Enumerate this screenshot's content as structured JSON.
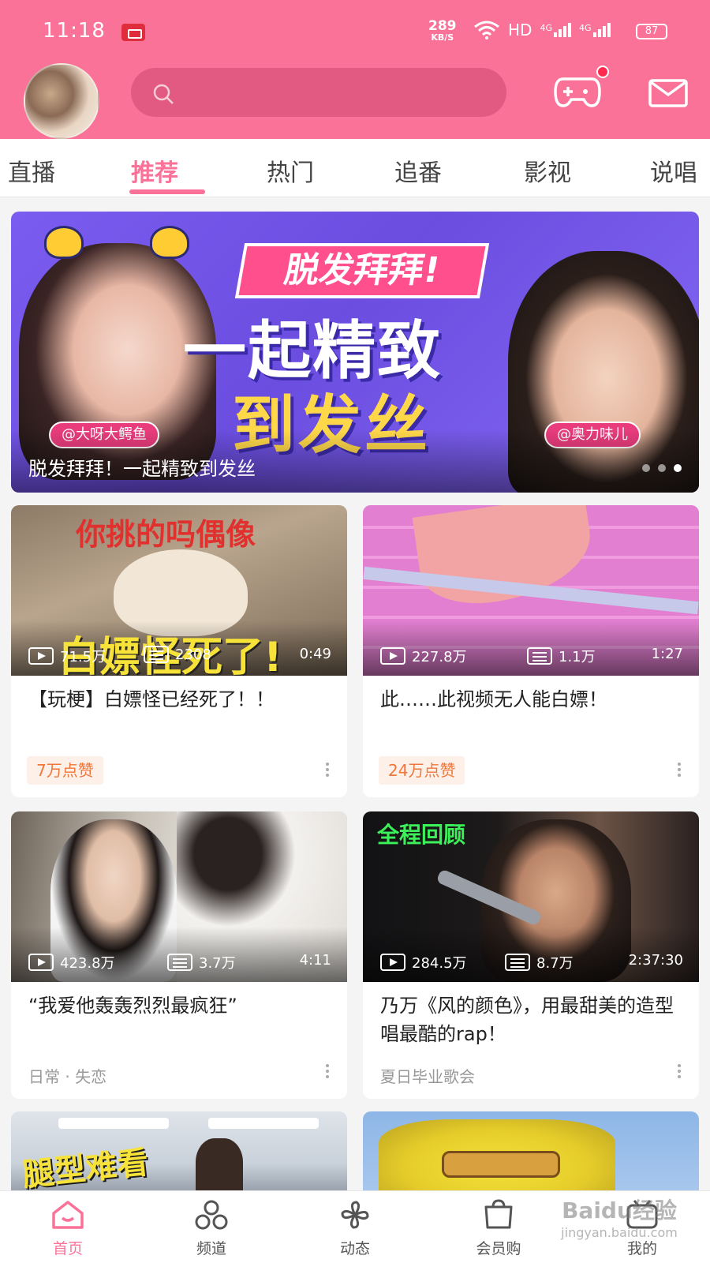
{
  "status_bar": {
    "time": "11:18",
    "net_speed_value": "289",
    "net_speed_unit": "KB/S",
    "hd": "HD",
    "signal1": "4G",
    "signal2": "4G",
    "battery": "87"
  },
  "header": {
    "accent_color": "#fb7299",
    "search_placeholder": ""
  },
  "tabs": [
    {
      "label": "直播"
    },
    {
      "label": "推荐",
      "active": true
    },
    {
      "label": "热门"
    },
    {
      "label": "追番"
    },
    {
      "label": "影视"
    },
    {
      "label": "说唱"
    }
  ],
  "banner": {
    "sign_text": "脱发拜拜!",
    "headline_1": "一起精致",
    "headline_2": "到发丝",
    "tag_left": "@大呀大鳄鱼",
    "tag_right": "@奥力味儿",
    "caption": "脱发拜拜！一起精致到发丝",
    "dots": 3,
    "active_dot": 2
  },
  "cards": [
    {
      "overlay_top": "你挑的吗偶像",
      "overlay_bottom": "白嫖怪死了!",
      "plays": "71.5万",
      "danmaku": "2308",
      "duration": "0:49",
      "title": "【玩梗】白嫖怪已经死了！！",
      "badge": "7万点赞"
    },
    {
      "plays": "227.8万",
      "danmaku": "1.1万",
      "duration": "1:27",
      "title": "此……此视频无人能白嫖！",
      "badge": "24万点赞"
    },
    {
      "plays": "423.8万",
      "danmaku": "3.7万",
      "duration": "4:11",
      "title": "“我爱他轰轰烈烈最疯狂”",
      "subline": "日常 · 失恋"
    },
    {
      "overlay_top": "全程回顾",
      "plays": "284.5万",
      "danmaku": "8.7万",
      "duration": "2:37:30",
      "title": "乃万《风的颜色》，用最甜美的造型唱最酷的rap！",
      "subline": "夏日毕业歌会"
    },
    {
      "overlay_top": "腿型难看"
    },
    {}
  ],
  "bottom_nav": [
    {
      "label": "首页",
      "icon": "home-icon",
      "active": true
    },
    {
      "label": "频道",
      "icon": "channel-icon"
    },
    {
      "label": "动态",
      "icon": "dynamic-icon"
    },
    {
      "label": "会员购",
      "icon": "shop-icon"
    },
    {
      "label": "我的",
      "icon": "profile-icon"
    }
  ],
  "watermark": {
    "logo": "Baidu经验",
    "url": "jingyan.baidu.com"
  }
}
